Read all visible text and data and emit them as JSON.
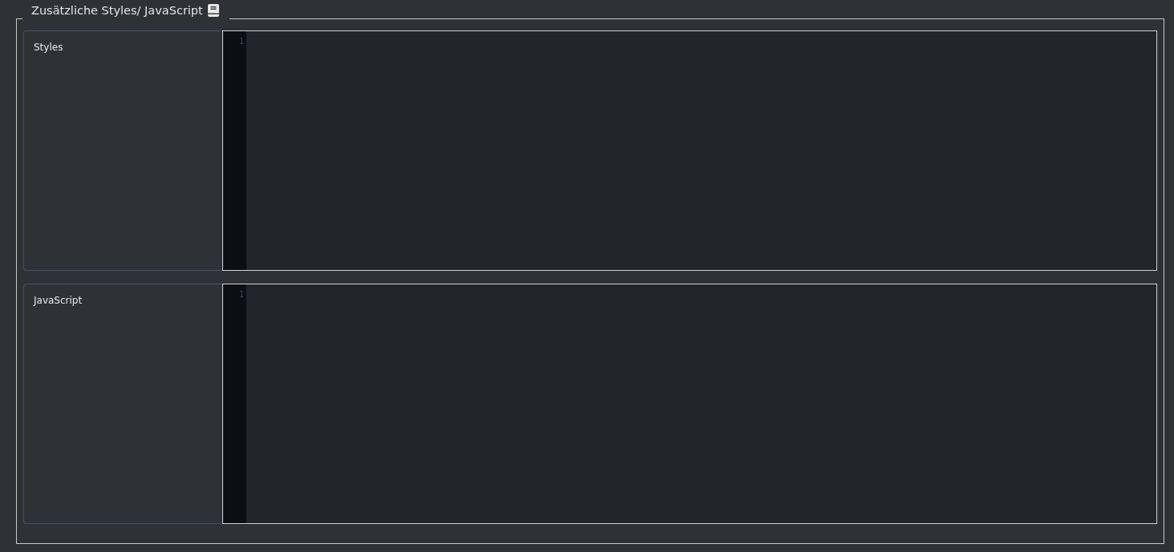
{
  "section": {
    "title": "Zusätzliche Styles/ JavaScript"
  },
  "fields": [
    {
      "label": "Styles",
      "line_numbers": [
        "1"
      ]
    },
    {
      "label": "JavaScript",
      "line_numbers": [
        "1"
      ]
    }
  ]
}
